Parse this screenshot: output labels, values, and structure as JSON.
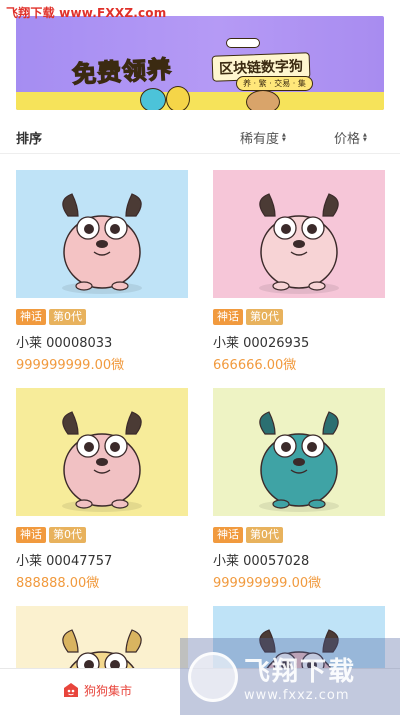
{
  "watermark": {
    "site_label": "飞翔下载 www.FXXZ.com",
    "brand_cn": "飞翔下载",
    "brand_url": "www.fxxz.com"
  },
  "banner": {
    "headline": "免费领养",
    "subtitle": "区块链数字狗",
    "tagline": "养 · 繁 · 交易 · 集"
  },
  "sortbar": {
    "label": "排序",
    "options": [
      {
        "label": "稀有度"
      },
      {
        "label": "价格"
      }
    ]
  },
  "cards": [
    {
      "bg": "#bfe3f7",
      "tags": [
        "神话",
        "第0代"
      ],
      "name": "小莱 00008033",
      "price": "999999999.00微",
      "dog_color": "#f4c3c4",
      "ear_color": "#4b3b35"
    },
    {
      "bg": "#f6c6d8",
      "tags": [
        "神话",
        "第0代"
      ],
      "name": "小莱 00026935",
      "price": "666666.00微",
      "dog_color": "#f7d3d5",
      "ear_color": "#4b3b35"
    },
    {
      "bg": "#f7ec9a",
      "tags": [
        "神话",
        "第0代"
      ],
      "name": "小莱 00047757",
      "price": "888888.00微",
      "dog_color": "#f1c1c3",
      "ear_color": "#4b3b35"
    },
    {
      "bg": "#eef3c4",
      "tags": [
        "神话",
        "第0代"
      ],
      "name": "小莱 00057028",
      "price": "999999999.00微",
      "dog_color": "#3fa3a5",
      "ear_color": "#2b6f71"
    },
    {
      "bg": "#fbf1cf",
      "tags": [],
      "name": "",
      "price": "",
      "dog_color": "#f3d88d",
      "ear_color": "#d9b460"
    },
    {
      "bg": "#bfe3f7",
      "tags": [],
      "name": "",
      "price": "",
      "dog_color": "#f4c3c4",
      "ear_color": "#4b3b35"
    }
  ],
  "bottom_nav": {
    "items": [
      {
        "label": "狗狗集市",
        "icon": "shop-icon"
      }
    ]
  },
  "colors": {
    "accent": "#f19a3e",
    "nav_active": "#e8453c"
  }
}
